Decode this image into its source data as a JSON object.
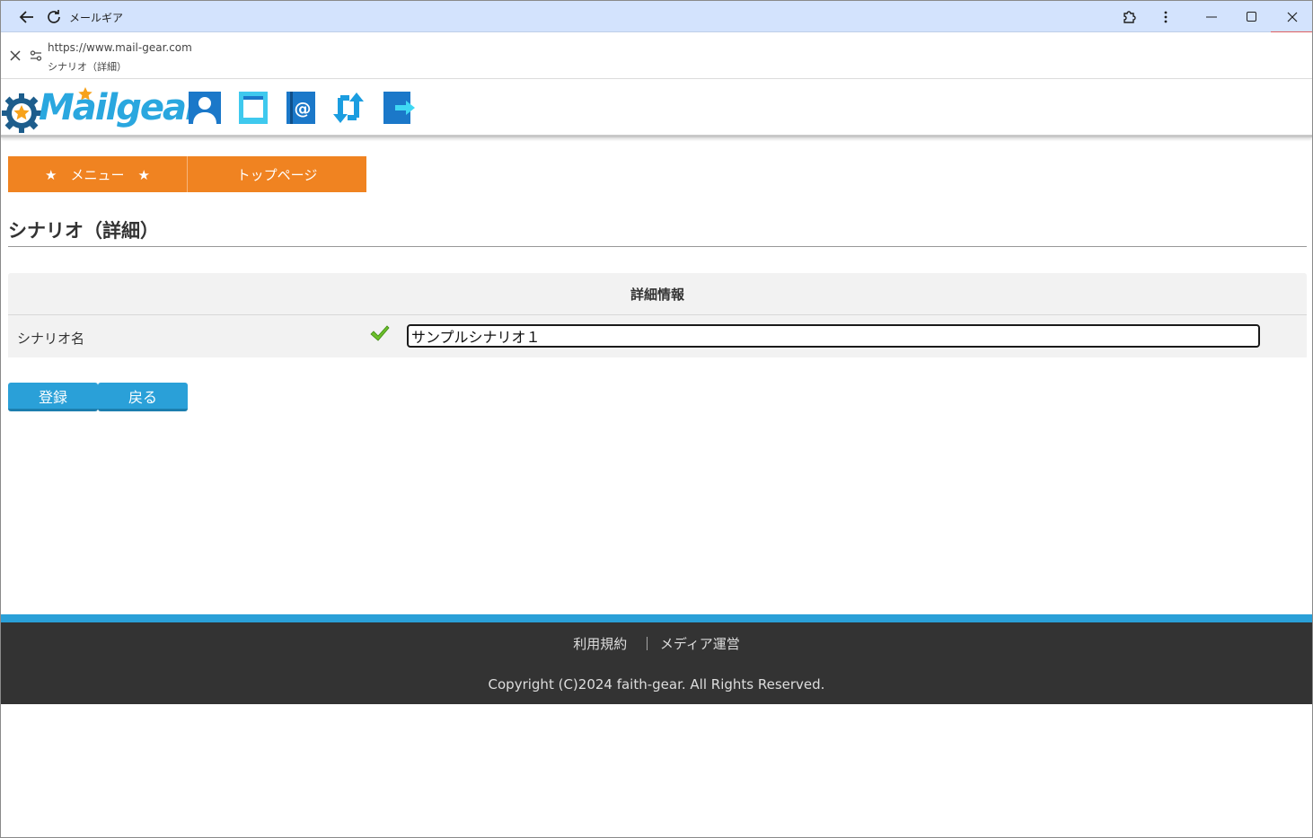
{
  "browser": {
    "tab_title": "メールギア",
    "url": "https://www.mail-gear.com",
    "page_title": "シナリオ（詳細）",
    "icons": [
      "back-icon",
      "reload-icon",
      "extensions-icon",
      "more-icon",
      "minimize-icon",
      "maximize-icon",
      "close-icon",
      "stop-icon",
      "site-settings-icon"
    ]
  },
  "site": {
    "logo_text": "Mailgear",
    "nav_icons": [
      "user-icon",
      "book-icon",
      "address-book-icon",
      "sync-icon",
      "logout-icon"
    ],
    "colors": {
      "brand_blue": "#2aa7df",
      "orange": "#f08321",
      "footer": "#333333"
    }
  },
  "menu": {
    "items": [
      {
        "label": "★　メニュー　★"
      },
      {
        "label": "トップページ"
      }
    ]
  },
  "page": {
    "title": "シナリオ（詳細）",
    "section_header": "詳細情報",
    "field_label": "シナリオ名",
    "field_value": "サンプルシナリオ１"
  },
  "actions": {
    "register_label": "登録",
    "back_label": "戻る"
  },
  "footer": {
    "terms": "利用規約",
    "separator": "｜",
    "media": "メディア運営",
    "copyright": "Copyright (C)2024 faith-gear. All Rights Reserved."
  }
}
